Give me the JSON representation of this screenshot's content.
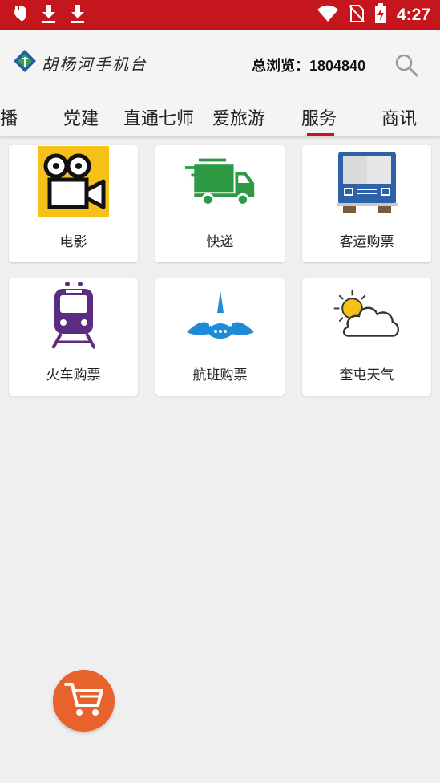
{
  "status_bar": {
    "time": "4:27",
    "left_icons": [
      "evernote-icon",
      "download-icon",
      "download-icon"
    ],
    "right_icons": [
      "wifi-icon",
      "no-sim-icon",
      "battery-charging-icon"
    ]
  },
  "header": {
    "logo_text": "胡杨河手机台",
    "visits_label": "总浏览：1804840"
  },
  "tabs": [
    {
      "label": "直播"
    },
    {
      "label": "党建"
    },
    {
      "label": "直通七师"
    },
    {
      "label": "爱旅游"
    },
    {
      "label": "服务",
      "active": true
    },
    {
      "label": "商讯"
    }
  ],
  "services": [
    {
      "label": "电影",
      "icon": "movie-camera-icon"
    },
    {
      "label": "快递",
      "icon": "delivery-truck-icon"
    },
    {
      "label": "客运购票",
      "icon": "bus-icon"
    },
    {
      "label": "火车购票",
      "icon": "train-icon"
    },
    {
      "label": "航班购票",
      "icon": "airplane-icon"
    },
    {
      "label": "奎屯天气",
      "icon": "weather-icon"
    }
  ],
  "colors": {
    "status_bar": "#c4161c",
    "active_tab_underline": "#c4161c",
    "cart_button": "#e8622c"
  }
}
